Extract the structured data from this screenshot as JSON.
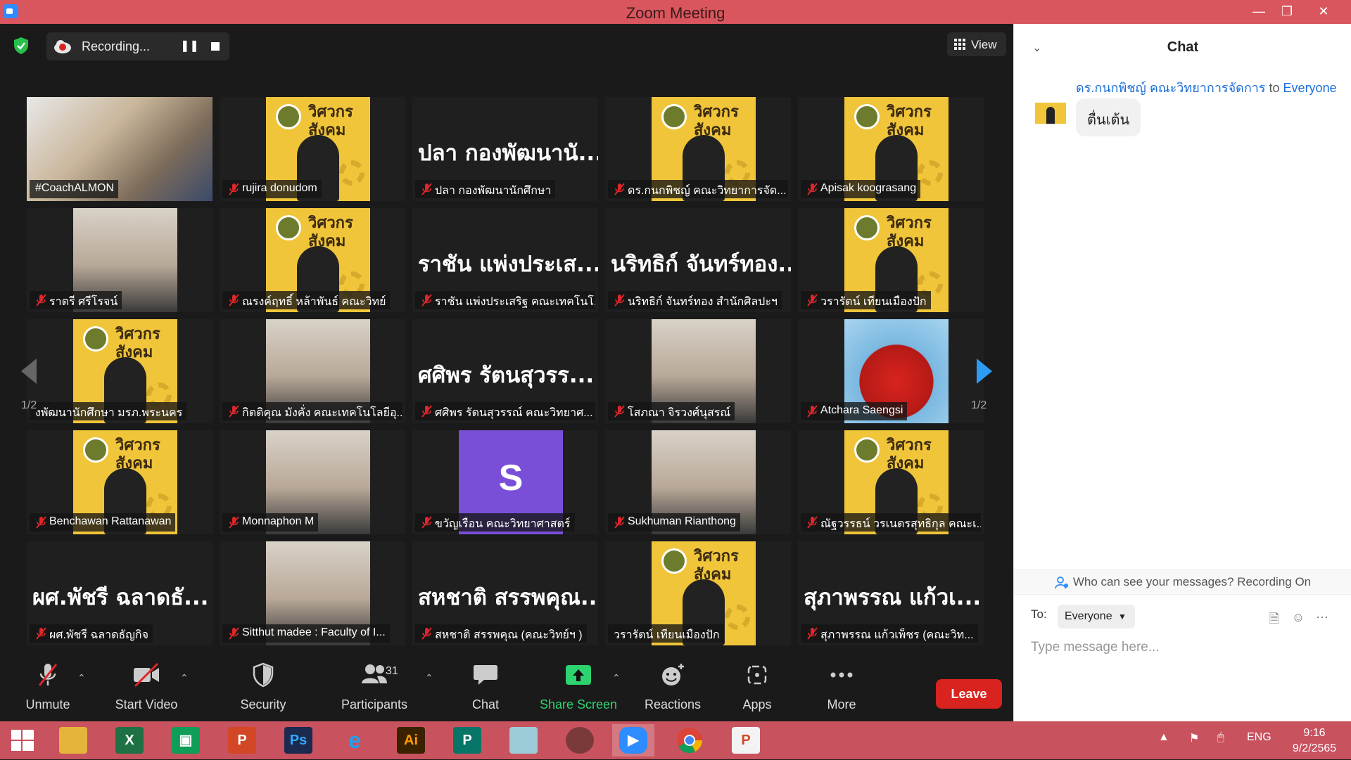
{
  "window": {
    "title": "Zoom Meeting"
  },
  "topbar": {
    "recording_text": "Recording...",
    "view_label": "View"
  },
  "gallery": {
    "page_left": "1/2",
    "page_right": "1/2",
    "tiles": [
      {
        "label": "#CoachALMON",
        "big": "",
        "muted": false
      },
      {
        "label": "rujira donudom",
        "big": "",
        "muted": true
      },
      {
        "label": "ปลา กองพัฒนานักศึกษา",
        "big": "ปลา กองพัฒนานั...",
        "muted": true
      },
      {
        "label": "ดร.กนกพิชญ์ คณะวิทยาการจัด...",
        "big": "",
        "muted": true
      },
      {
        "label": "Apisak koograsang",
        "big": "",
        "muted": true
      },
      {
        "label": "ราตรี ศรีโรจน์",
        "big": "",
        "muted": true
      },
      {
        "label": "ณรงค์ฤทธิ์ หล้าพันธ์ คณะวิทย์",
        "big": "",
        "muted": true
      },
      {
        "label": "ราชัน แพ่งประเสริฐ คณะเทคโนโ...",
        "big": "ราชัน แพ่งประเส...",
        "muted": true
      },
      {
        "label": "นริทธิก์ จันทร์ทอง สำนักศิลปะฯ",
        "big": "นริทธิก์ จันทร์ทอง...",
        "muted": true
      },
      {
        "label": "วรารัตน์ เทียนเมืองปัก",
        "big": "",
        "muted": true
      },
      {
        "label": "งพัฒนานักศึกษา มรภ.พระนคร",
        "big": "",
        "muted": false
      },
      {
        "label": "กิตติคุณ มังคั่ง คณะเทคโนโลยีอุ...",
        "big": "",
        "muted": true
      },
      {
        "label": "ศศิพร รัตนสุวรรณ์ คณะวิทยาศ...",
        "big": "ศศิพร รัตนสุวรร...",
        "muted": true
      },
      {
        "label": "โสภณา จิรวงศ์นุสรณ์",
        "big": "",
        "muted": true
      },
      {
        "label": "Atchara Saengsi",
        "big": "",
        "muted": true
      },
      {
        "label": "Benchawan Rattanawan",
        "big": "",
        "muted": true
      },
      {
        "label": "Monnaphon M",
        "big": "",
        "muted": true
      },
      {
        "label": "ขวัญเรือน คณะวิทยาศาสตร์",
        "big": "",
        "muted": true,
        "avatar_letter": "S"
      },
      {
        "label": "Sukhuman Rianthong",
        "big": "",
        "muted": true
      },
      {
        "label": "ณัฐวรรธน์ วรเนตรสุทธิกุล คณะเ...",
        "big": "",
        "muted": true
      },
      {
        "label": "ผศ.พัชรี ฉลาดธัญกิจ",
        "big": "ผศ.พัชรี ฉลาดธั...",
        "muted": true
      },
      {
        "label": "Sitthut madee : Faculty of I...",
        "big": "",
        "muted": true
      },
      {
        "label": "สหชาติ สรรพคุณ (คณะวิทย์ฯ )",
        "big": "สหชาติ สรรพคุณ...",
        "muted": true
      },
      {
        "label": "วรารัตน์ เทียนเมืองปัก",
        "big": "",
        "muted": false
      },
      {
        "label": "สุภาพรรณ แก้วเพ็ชร (คณะวิท...",
        "big": "สุภาพรรณ แก้วเ...",
        "muted": true
      }
    ],
    "poster_text": "วิศวกร\nสังคม"
  },
  "toolbar": {
    "unmute": "Unmute",
    "start_video": "Start Video",
    "security": "Security",
    "participants": "Participants",
    "participant_count": "31",
    "chat": "Chat",
    "share_screen": "Share Screen",
    "reactions": "Reactions",
    "apps": "Apps",
    "more": "More",
    "leave": "Leave"
  },
  "chat": {
    "title": "Chat",
    "sender": "ดร.กนกพิชญ์ คณะวิทยาการจัดการ",
    "to_word": "to",
    "recipient_in_msg": "Everyone",
    "message": "ตื่นเต้น",
    "notice": "Who can see your messages? Recording On",
    "to_label": "To:",
    "recipient": "Everyone",
    "placeholder": "Type message here..."
  },
  "taskbar": {
    "items": [
      "windows-start",
      "file-explorer",
      "excel",
      "store",
      "powerpoint",
      "photoshop",
      "internet-explorer",
      "illustrator",
      "publisher",
      "notepad",
      "photoscape",
      "zoom",
      "chrome",
      "powerpoint-2"
    ],
    "lang": "ENG",
    "time": "9:16",
    "date": "9/2/2565"
  },
  "colors": {
    "accent": "#2d8cff",
    "leave": "#d8231f",
    "share_green": "#2dd36f",
    "titlebar": "#d9565e",
    "poster": "#f0c53a"
  }
}
